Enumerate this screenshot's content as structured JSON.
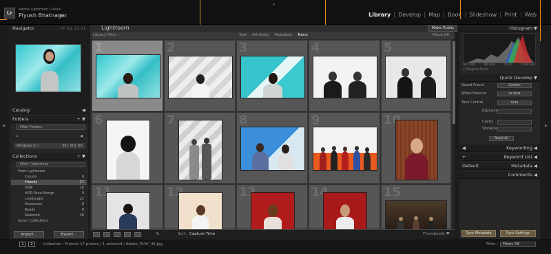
{
  "app": {
    "small_title": "Adobe Lightroom Classic",
    "user": "Piyush Bhatnagar"
  },
  "modules": [
    "Library",
    "Develop",
    "Map",
    "Book",
    "Slideshow",
    "Print",
    "Web"
  ],
  "active_module": "Library",
  "left_panel": {
    "navigator": {
      "title": "Navigator",
      "options": [
        "FIT",
        "FILL",
        "1:1",
        "3:1"
      ]
    },
    "catalog": "Catalog",
    "folders": {
      "title": "Folders",
      "filter_label": "Filter Folders",
      "volume": "Windows (C:)",
      "volume_size": "96 / 201 GB"
    },
    "collections": {
      "title": "Collections",
      "filter_label": "Filter Collections",
      "items": [
        {
          "label": "From Lightroom",
          "count": ""
        },
        {
          "label": "Clouds",
          "count": "0"
        },
        {
          "label": "Friends",
          "count": "17"
        },
        {
          "label": "HDR",
          "count": "16"
        },
        {
          "label": "HDR-Pano-Merge",
          "count": "9"
        },
        {
          "label": "Landscape",
          "count": "22"
        },
        {
          "label": "Panorama",
          "count": "8"
        },
        {
          "label": "Roads",
          "count": "8"
        },
        {
          "label": "Selected",
          "count": "28"
        },
        {
          "label": "Smart Collections",
          "count": ""
        }
      ]
    },
    "import_label": "Import...",
    "export_label": "Export..."
  },
  "center": {
    "title": "Lightroom",
    "make_public": "Make Public",
    "library_filter": "Library Filter :",
    "filter_tabs": [
      "Text",
      "Attribute",
      "Metadata",
      "None"
    ],
    "filter_active": "None",
    "filters_off": "Filters Off",
    "numbers": [
      "1",
      "2",
      "3",
      "4",
      "5",
      "6",
      "7",
      "8",
      "9",
      "10",
      "11",
      "12",
      "13",
      "14",
      "15"
    ],
    "sort_label": "Sort:",
    "sort_value": "Capture Time",
    "thumbnails_label": "Thumbnails"
  },
  "right_panel": {
    "histogram": "Histogram",
    "histo_info": [
      "ISO 100",
      "80 mm",
      "f/4.0",
      "1/160 sec"
    ],
    "original_photo": "Original Photo",
    "quick_develop": "Quick Develop",
    "saved_preset": {
      "label": "Saved Preset",
      "value": "Custom"
    },
    "white_balance": {
      "label": "White Balance",
      "value": "As Shot"
    },
    "tone_control": {
      "label": "Tone Control",
      "value": "Auto"
    },
    "sliders": [
      "Exposure",
      "Clarity",
      "Vibrance"
    ],
    "reset_all": "Reset All",
    "keywording": "Keywording",
    "keyword_list": "Keyword List",
    "metadata": {
      "label": "Metadata",
      "preset": "Default"
    },
    "comments": "Comments",
    "sync_metadata": "Sync Metadata",
    "sync_settings": "Sync Settings"
  },
  "bottom": {
    "pages": [
      "1",
      "2"
    ],
    "status": "Collection : Friends    17 photos / 1 selected / Adobe_PLAY_46.jpg",
    "filter_label": "Filter :",
    "filter_value": "Filters Off"
  },
  "colors": {
    "accent_orange": "#e8902a",
    "panel_bg": "#262626",
    "selected_cell": "#8a8a8a"
  }
}
